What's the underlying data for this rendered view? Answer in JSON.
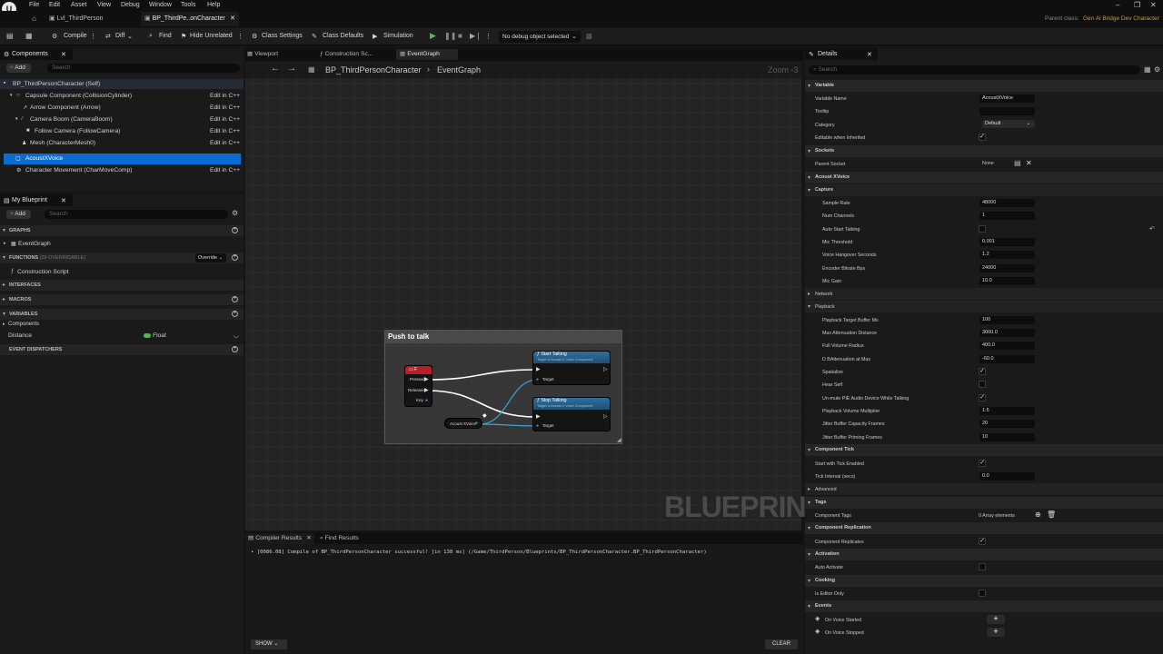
{
  "menu": {
    "items": [
      "File",
      "Edit",
      "Asset",
      "View",
      "Debug",
      "Window",
      "Tools",
      "Help"
    ]
  },
  "tabs": [
    {
      "label": "Lvl_ThirdPerson"
    },
    {
      "label": "BP_ThirdPe..onCharacter"
    }
  ],
  "parent_class": {
    "label": "Parent class:",
    "value": "Gen Ai Bridge Dev Character"
  },
  "toolbar": {
    "compile": "Compile",
    "diff": "Diff",
    "find": "Find",
    "hide_unrelated": "Hide Unrelated",
    "class_settings": "Class Settings",
    "class_defaults": "Class Defaults",
    "simulation": "Simulation",
    "debug_object": "No debug object selected"
  },
  "components": {
    "title": "Components",
    "add_label": "Add",
    "search_placeholder": "Search",
    "edit_label": "Edit in C++",
    "items": [
      {
        "label": "BP_ThirdPersonCharacter (Self)"
      },
      {
        "label": "Capsule Component (CollisionCylinder)"
      },
      {
        "label": "Arrow Component (Arrow)"
      },
      {
        "label": "Camera Boom (CameraBoom)"
      },
      {
        "label": "Follow Camera (FollowCamera)"
      },
      {
        "label": "Mesh (CharacterMesh0)"
      },
      {
        "label": "AcoustXVoice"
      },
      {
        "label": "Character Movement (CharMoveComp)"
      }
    ]
  },
  "my_blueprint": {
    "title": "My Blueprint",
    "add_label": "Add",
    "search_placeholder": "Search",
    "sections": {
      "graphs": "GRAPHS",
      "event_graph": "EventGraph",
      "functions": "FUNCTIONS",
      "functions_note": "(39 OVERRIDABLE)",
      "override": "Override",
      "construction_script": "Construction Script",
      "interfaces": "INTERFACES",
      "macros": "MACROS",
      "variables": "VARIABLES",
      "components": "Components",
      "distance": "Distance",
      "distance_type": "Float",
      "event_dispatchers": "EVENT DISPATCHERS"
    }
  },
  "editor_tabs": [
    {
      "label": "Viewport"
    },
    {
      "label": "Construction Sc..."
    },
    {
      "label": "EventGraph"
    }
  ],
  "breadcrumb": {
    "root": "BP_ThirdPersonCharacter",
    "graph": "EventGraph"
  },
  "zoom": "Zoom -3",
  "watermark": "BLUEPRINT",
  "comment_box": {
    "title": "Push to talk"
  },
  "nodes": {
    "f_key": {
      "title": "F",
      "pins": [
        "Pressed",
        "Released",
        "Key"
      ]
    },
    "start_talking": {
      "title": "Start Talking",
      "subtitle": "Target is Acoust X Voice Component",
      "pin": "Target"
    },
    "stop_talking": {
      "title": "Stop Talking",
      "subtitle": "Target is Acoust X Voice Component",
      "pin": "Target"
    },
    "var_node": {
      "label": "Acoust XVoice"
    }
  },
  "compiler": {
    "tabs": [
      {
        "label": "Compiler Results"
      },
      {
        "label": "Find Results"
      }
    ],
    "log": "• [0086.08] Compile of BP_ThirdPersonCharacter successful! [in 138 ms] (/Game/ThirdPerson/Blueprints/BP_ThirdPersonCharacter.BP_ThirdPersonCharacter)",
    "show": "SHOW",
    "clear": "CLEAR"
  },
  "details": {
    "title": "Details",
    "search_placeholder": "Search",
    "variable_section": "Variable",
    "variable_name_label": "Variable Name",
    "variable_name": "AcoustXVoice",
    "tooltip_label": "Tooltip",
    "category_label": "Category",
    "category": "Default",
    "editable_label": "Editable when Inherited",
    "sockets_section": "Sockets",
    "parent_socket_label": "Parent Socket",
    "parent_socket": "None",
    "acoust_section": "Acoust XVoice",
    "capture_section": "Capture",
    "sample_rate_label": "Sample Rate",
    "sample_rate": "48000",
    "num_channels_label": "Num Channels",
    "num_channels": "1",
    "auto_start_label": "Auto Start Talking",
    "mic_threshold_label": "Mic Threshold",
    "mic_threshold": "0.001",
    "hangover_label": "Voice Hangover Seconds",
    "hangover": "1.2",
    "bitrate_label": "Encoder Bitrate Bps",
    "bitrate": "24000",
    "mic_gain_label": "Mic Gain",
    "mic_gain": "10.0",
    "network_section": "Network",
    "playback_section": "Playback",
    "target_buffer_label": "Playback Target Buffer Ms",
    "target_buffer": "100",
    "max_atten_label": "Max Attenuation Distance",
    "max_atten": "3000.0",
    "full_volume_label": "Full Volume Radius",
    "full_volume": "400.0",
    "db_atten_label": "D BAttenuation at Max",
    "db_atten": "-60.0",
    "spatialize_label": "Spatialize",
    "hear_self_label": "Hear Self",
    "unmute_label": "Un-mute PIE Audio Device While Talking",
    "volume_mult_label": "Playback Volume Multiplier",
    "volume_mult": "1.5",
    "jitter_capacity_label": "Jitter Buffer Capacity Frames",
    "jitter_capacity": "20",
    "jitter_priming_label": "Jitter Buffer Priming Frames",
    "jitter_priming": "10",
    "component_tick_section": "Component Tick",
    "start_tick_label": "Start with Tick Enabled",
    "tick_interval_label": "Tick Interval (secs)",
    "tick_interval": "0.0",
    "advanced_section": "Advanced",
    "tags_section": "Tags",
    "component_tags_label": "Component Tags",
    "component_tags": "0 Array elements",
    "replication_section": "Component Replication",
    "replicates_label": "Component Replicates",
    "activation_section": "Activation",
    "auto_activate_label": "Auto Activate",
    "cooking_section": "Cooking",
    "editor_only_label": "Is Editor Only",
    "events_section": "Events",
    "on_voice_started": "On Voice Started",
    "on_voice_stopped": "On Voice Stopped"
  }
}
